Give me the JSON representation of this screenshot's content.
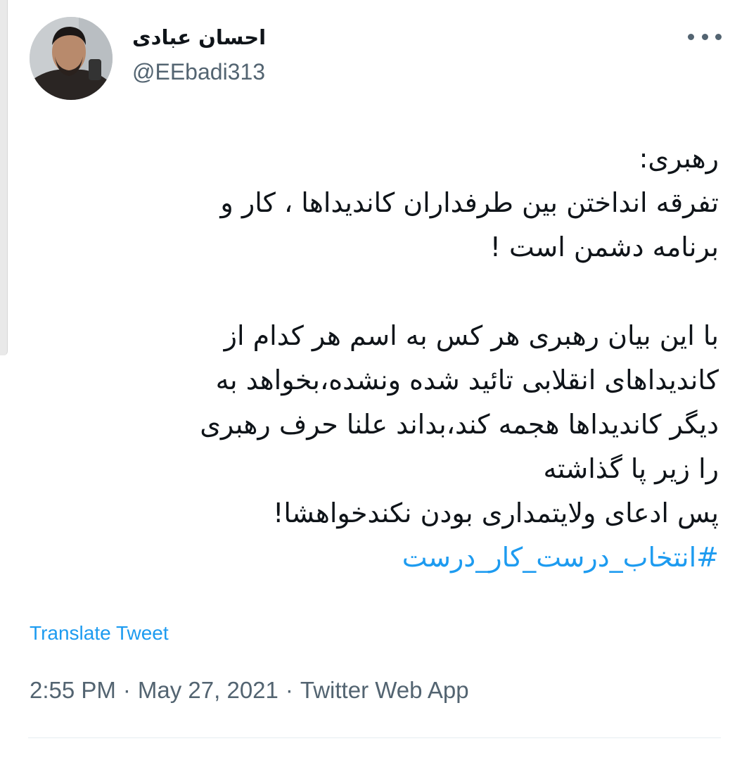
{
  "author": {
    "display_name": "احسان عبادی",
    "handle": "@EEbadi313"
  },
  "actions": {
    "more_icon": "more-horizontal-icon"
  },
  "tweet": {
    "lines": [
      "رهبری:",
      "تفرقه انداختن بین طرفداران کاندیداها ، کار و",
      "برنامه دشمن است !",
      "",
      "با این بیان رهبری هر کس به اسم هر کدام از",
      "کاندیداهای انقلابی تائید شده ونشده،بخواهد به",
      "دیگر کاندیداها هجمه کند،بداند علنا حرف رهبری",
      "را زیر پا گذاشته",
      "پس ادعای ولایتمداری بودن نکندخواهشا!"
    ],
    "hashtag": "#انتخاب_درست_کار_درست"
  },
  "translate_label": "Translate Tweet",
  "meta": {
    "time": "2:55 PM",
    "separator": "·",
    "date": "May 27, 2021",
    "source": "Twitter Web App"
  },
  "colors": {
    "link": "#1d9bf0",
    "secondary_text": "#536471",
    "primary_text": "#0f1419"
  }
}
